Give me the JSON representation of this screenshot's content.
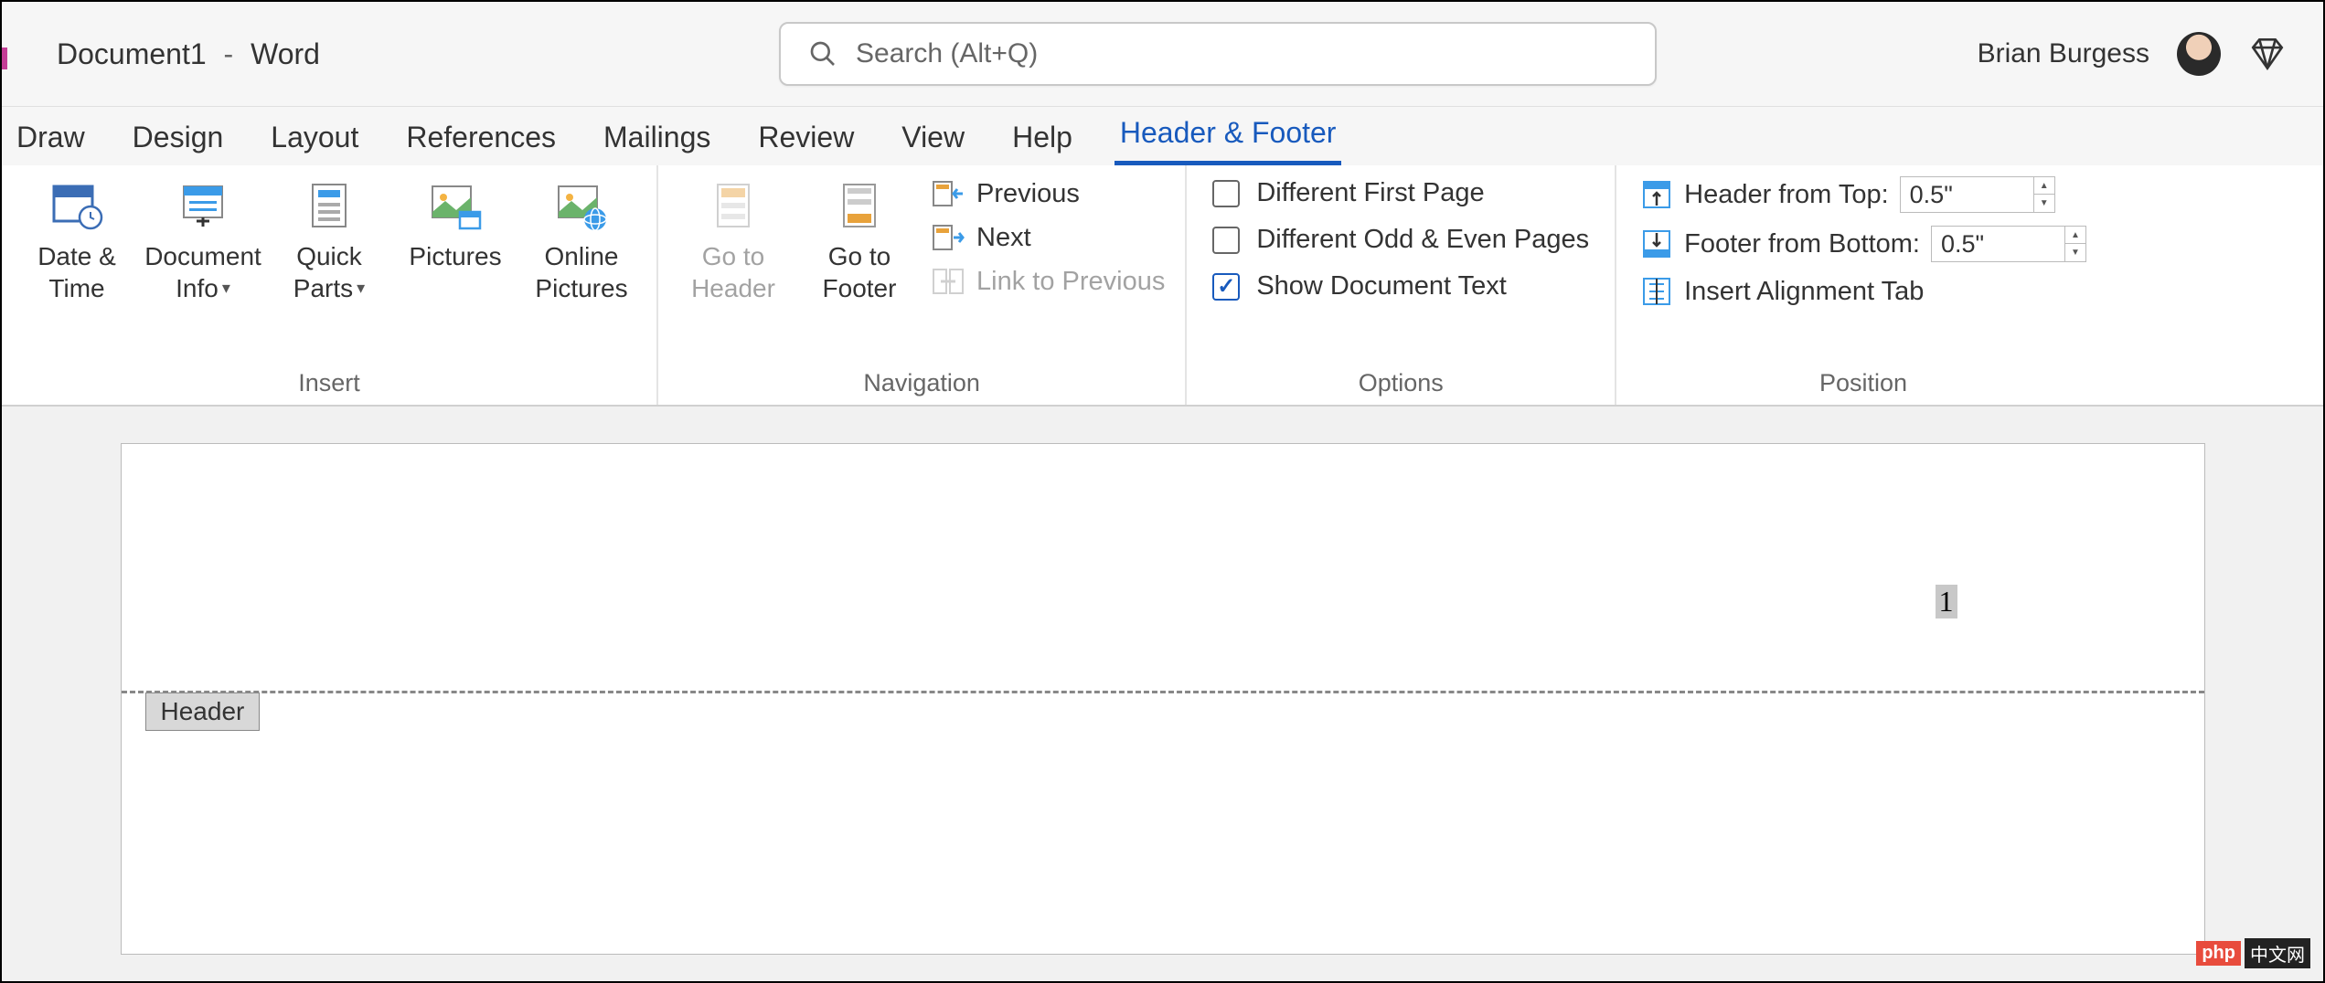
{
  "title": {
    "doc": "Document1",
    "sep": "-",
    "app": "Word"
  },
  "search": {
    "placeholder": "Search (Alt+Q)"
  },
  "user": {
    "name": "Brian Burgess"
  },
  "tabs": [
    "Draw",
    "Design",
    "Layout",
    "References",
    "Mailings",
    "Review",
    "View",
    "Help",
    "Header & Footer"
  ],
  "active_tab": "Header & Footer",
  "ribbon": {
    "insert": {
      "label": "Insert",
      "buttons": {
        "date_time_l1": "Date &",
        "date_time_l2": "Time",
        "doc_info_l1": "Document",
        "doc_info_l2": "Info",
        "quick_l1": "Quick",
        "quick_l2": "Parts",
        "pictures": "Pictures",
        "online_l1": "Online",
        "online_l2": "Pictures"
      }
    },
    "navigation": {
      "label": "Navigation",
      "goto_header_l1": "Go to",
      "goto_header_l2": "Header",
      "goto_footer_l1": "Go to",
      "goto_footer_l2": "Footer",
      "previous": "Previous",
      "next": "Next",
      "link": "Link to Previous"
    },
    "options": {
      "label": "Options",
      "diff_first": "Different First Page",
      "diff_odd": "Different Odd & Even Pages",
      "show_doc": "Show Document Text"
    },
    "position": {
      "label": "Position",
      "header_top": "Header from Top:",
      "footer_bottom": "Footer from Bottom:",
      "align_tab": "Insert Alignment Tab",
      "header_val": "0.5\"",
      "footer_val": "0.5\""
    }
  },
  "document": {
    "page_number": "1",
    "header_tag": "Header"
  },
  "watermark": {
    "a": "php",
    "b": "中文网"
  }
}
